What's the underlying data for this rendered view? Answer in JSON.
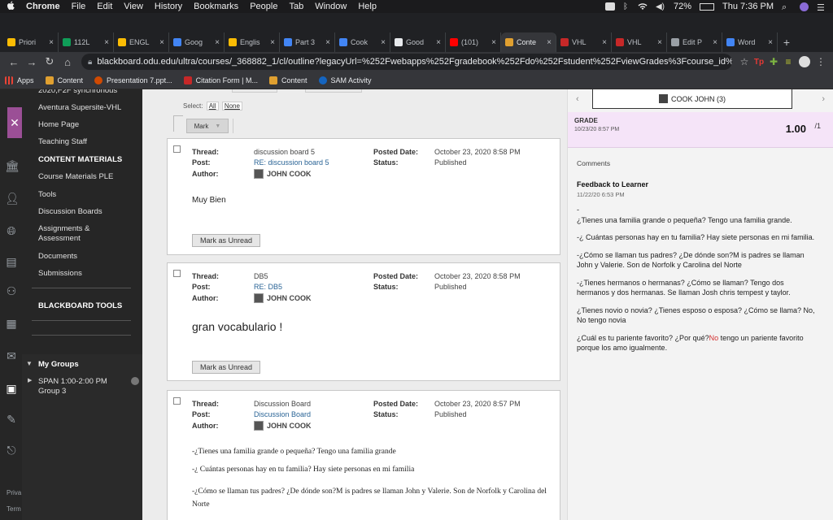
{
  "menubar": {
    "app": "Chrome",
    "items": [
      "File",
      "Edit",
      "View",
      "History",
      "Bookmarks",
      "People",
      "Tab",
      "Window",
      "Help"
    ],
    "battery": "72%",
    "clock": "Thu 7:36 PM"
  },
  "tabs": [
    {
      "label": "Priori",
      "color": "#fbbc04"
    },
    {
      "label": "112L",
      "color": "#0f9d58"
    },
    {
      "label": "ENGL",
      "color": "#fbbc04"
    },
    {
      "label": "Goog",
      "color": "#4285f4"
    },
    {
      "label": "Englis",
      "color": "#fbbc04"
    },
    {
      "label": "Part 3",
      "color": "#4285f4"
    },
    {
      "label": "Cook",
      "color": "#4285f4"
    },
    {
      "label": "Good",
      "color": "#e8eaed"
    },
    {
      "label": "(101)",
      "color": "#ff0000"
    },
    {
      "label": "Conte",
      "color": "#e0a030"
    },
    {
      "label": "VHL",
      "color": "#c62828"
    },
    {
      "label": "VHL",
      "color": "#c62828"
    },
    {
      "label": "Edit P",
      "color": "#9aa0a6"
    },
    {
      "label": "Word",
      "color": "#4285f4"
    }
  ],
  "toolbar": {
    "url": "blackboard.odu.edu/ultra/courses/_368882_1/cl/outline?legacyUrl=%252Fwebapps%252Fgradebook%252Fdo%252Fstudent%252FviewGrades%3Fcourse_id%3..."
  },
  "bookmarks": [
    {
      "label": "Apps",
      "color": "#ea4335"
    },
    {
      "label": "Content",
      "color": "#e0a030"
    },
    {
      "label": "Presentation 7.ppt...",
      "color": "#d04a02"
    },
    {
      "label": "Citation Form | M...",
      "color": "#c62828"
    },
    {
      "label": "Content",
      "color": "#e0a030"
    },
    {
      "label": "SAM Activity",
      "color": "#1565c0"
    }
  ],
  "sidenav": {
    "top_partial": "2020,F2F synchronous",
    "items": [
      "Aventura Supersite-VHL",
      "Home Page",
      "Teaching Staff",
      "CONTENT MATERIALS",
      "Course Materials PLE",
      "Tools",
      "Discussion Boards",
      "Assignments & Assessment",
      "Documents",
      "Submissions",
      "BLACKBOARD TOOLS"
    ],
    "my_groups": "My Groups",
    "group_item": "SPAN 1:00-2:00 PM Group 3",
    "bottom1": "Priva",
    "bottom2": "Term"
  },
  "main": {
    "select_label": "Select:",
    "select_all": "All",
    "select_none": "None",
    "mark_button": "Mark",
    "labels": {
      "thread": "Thread:",
      "post": "Post:",
      "author": "Author:",
      "posted": "Posted Date:",
      "status": "Status:"
    },
    "posts": [
      {
        "thread": "discussion board 5",
        "post": "RE: discussion board 5",
        "author": "JOHN COOK",
        "posted": "October 23, 2020 8:58 PM",
        "status": "Published",
        "body": "Muy Bien",
        "button": "Mark as Unread"
      },
      {
        "thread": "DB5",
        "post": "RE: DB5",
        "author": "JOHN COOK",
        "posted": "October 23, 2020 8:58 PM",
        "status": "Published",
        "body": "gran vocabulario !",
        "button": "Mark as Unread"
      },
      {
        "thread": "Discussion Board",
        "post": "Discussion Board",
        "author": "JOHN COOK",
        "posted": "October 23, 2020 8:57 PM",
        "status": "Published",
        "lines": [
          "-¿Tienes una familia grande o pequeña? Tengo una familia grande",
          "-¿ Cuántas personas hay en tu familia? Hay siete personas en mi familia",
          "-¿Cómo se llaman tus padres? ¿De dónde son?M is padres se llaman John y Valerie. Son de Norfolk y Carolina del Norte"
        ]
      }
    ]
  },
  "grader": {
    "student": "COOK JOHN (3)",
    "grade_label": "GRADE",
    "grade_date": "10/23/20 8:57 PM",
    "grade_value": "1.00",
    "grade_max": "/1",
    "comments_label": "Comments",
    "feedback_title": "Feedback to Learner",
    "feedback_date": "11/22/20 6:53 PM",
    "dash": "-",
    "feedback_lines": [
      "¿Tienes una familia grande o pequeña? Tengo una familia grande.",
      "-¿ Cuántas personas hay en tu familia? Hay siete personas en mi familia.",
      "-¿Cómo se llaman tus padres? ¿De dónde son?M is padres se llaman John y Valerie. Son de Norfolk y Carolina del Norte",
      "-¿Tienes hermanos o hermanas? ¿Cómo se llaman? Tengo dos hermanos y dos hermanas.  Se llaman Josh chris tempest y taylor.",
      "¿Tienes novio o novia? ¿Tienes esposo o esposa? ¿Cómo se llama? No, No tengo novia"
    ],
    "last_pre": "¿Cuál es tu pariente favorito? ¿Por qué?",
    "last_red": "No",
    "last_post": " tengo un pariente favorito porque los amo igualmente."
  }
}
